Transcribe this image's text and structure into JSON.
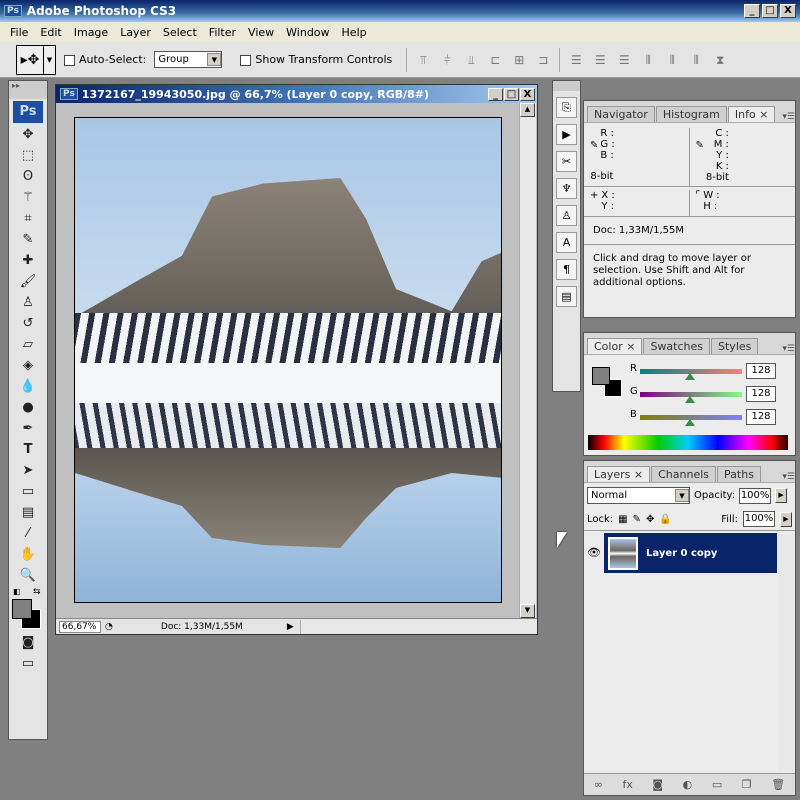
{
  "app": {
    "title": "Adobe Photoshop CS3",
    "icon": "Ps",
    "window_buttons": [
      "_",
      "□",
      "X"
    ]
  },
  "menu": [
    "File",
    "Edit",
    "Image",
    "Layer",
    "Select",
    "Filter",
    "View",
    "Window",
    "Help"
  ],
  "options": {
    "auto_select_label": "Auto-Select:",
    "auto_select_value": "Group",
    "show_transform_label": "Show Transform Controls"
  },
  "document": {
    "title": "1372167_19943050.jpg @ 66,7% (Layer 0 copy, RGB/8#)",
    "zoom": "66,67%",
    "doc_size": "Doc: 1,33M/1,55M"
  },
  "tools": [
    "move",
    "marquee",
    "lasso",
    "magic-wand",
    "crop",
    "slice",
    "healing",
    "brush",
    "stamp",
    "history-brush",
    "eraser",
    "bucket",
    "blur",
    "dodge",
    "pen",
    "type",
    "path-select",
    "shape",
    "notes",
    "eyedropper",
    "hand",
    "zoom"
  ],
  "info": {
    "tabs": [
      "Navigator",
      "Histogram",
      "Info"
    ],
    "rgb": [
      "R :",
      "G :",
      "B :"
    ],
    "cmyk": [
      "C :",
      "M :",
      "Y :",
      "K :"
    ],
    "bit_left": "8-bit",
    "bit_right": "8-bit",
    "xy": [
      "X :",
      "Y :"
    ],
    "wh": [
      "W :",
      "H :"
    ],
    "doc": "Doc: 1,33M/1,55M",
    "hint": "Click and drag to move layer or selection.  Use Shift and Alt for additional options."
  },
  "color": {
    "tabs": [
      "Color",
      "Swatches",
      "Styles"
    ],
    "channels": [
      {
        "label": "R",
        "value": "128"
      },
      {
        "label": "G",
        "value": "128"
      },
      {
        "label": "B",
        "value": "128"
      }
    ],
    "foreground": "#808080",
    "background": "#000000"
  },
  "layers": {
    "tabs": [
      "Layers",
      "Channels",
      "Paths"
    ],
    "blend_mode": "Normal",
    "opacity_label": "Opacity:",
    "opacity": "100%",
    "lock_label": "Lock:",
    "fill_label": "Fill:",
    "fill": "100%",
    "items": [
      {
        "name": "Layer 0 copy",
        "visible": true,
        "selected": true
      }
    ]
  },
  "colors": {
    "selection": "#0a246a",
    "titlebar": "#0a246a"
  }
}
